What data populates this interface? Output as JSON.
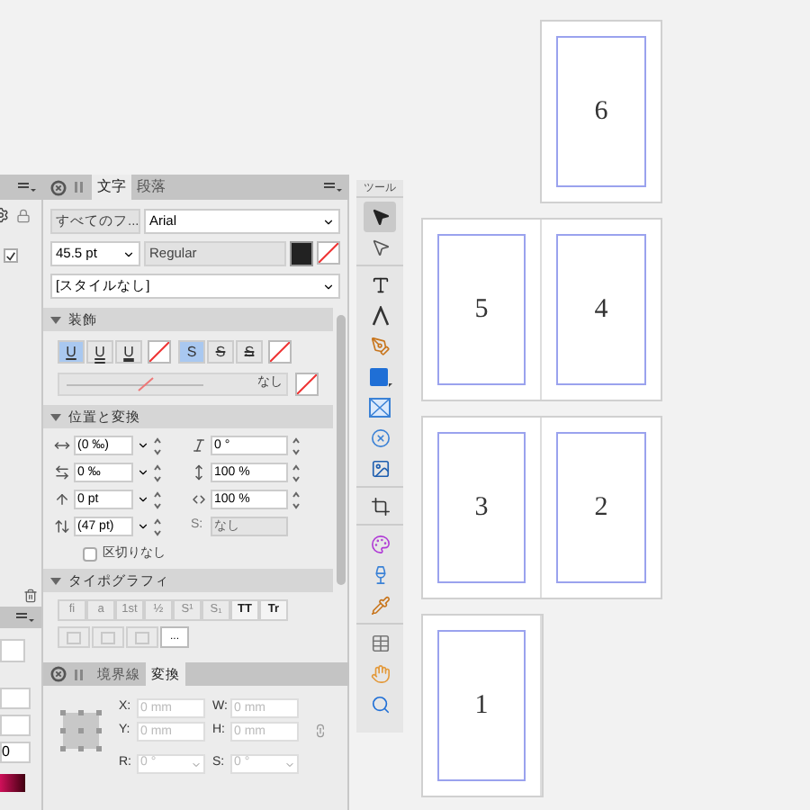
{
  "left_panel": {
    "field_value": "0",
    "checked": true
  },
  "character_panel": {
    "tabs": [
      {
        "label": "文字",
        "selected": true
      },
      {
        "label": "段落",
        "selected": false
      }
    ],
    "font_collection": "すべてのフ...",
    "font": "Arial",
    "size": "45.5 pt",
    "style": "Regular",
    "style_set": "[スタイルなし]",
    "sections": [
      {
        "title": "装飾",
        "expanded": true
      },
      {
        "title": "位置と変換",
        "expanded": true
      },
      {
        "title": "タイポグラフィ",
        "expanded": true
      }
    ],
    "decoration_buttons": [
      {
        "kind": "toggle",
        "label": "U",
        "selected": true
      },
      {
        "kind": "toggle",
        "label": "U",
        "selected": false
      },
      {
        "kind": "toggle",
        "label": "U",
        "selected": false
      },
      {
        "kind": "swatch"
      },
      {
        "kind": "toggle",
        "label": "S",
        "selected": true
      },
      {
        "kind": "toggle",
        "label": "S",
        "selected": false
      },
      {
        "kind": "toggle",
        "label": "S",
        "selected": false
      },
      {
        "kind": "swatch"
      }
    ],
    "line_value": "なし",
    "position_rows": [
      {
        "left_value": "(0 ‰)",
        "right_value": "0 °"
      },
      {
        "left_value": "0 ‰",
        "right_value": "100 %"
      },
      {
        "left_value": "0 pt",
        "right_value": "100 %"
      },
      {
        "left_value": "(47 pt)",
        "right_label": "S:",
        "right_value": "なし"
      }
    ],
    "no_break": {
      "label": "区切りなし",
      "checked": false
    },
    "typography_buttons": [
      {
        "label": "fi",
        "disabled": true
      },
      {
        "label": "a",
        "disabled": true
      },
      {
        "label": "1st",
        "disabled": true
      },
      {
        "label": "½",
        "disabled": true
      },
      {
        "label": "S¹",
        "disabled": true
      },
      {
        "label": "S₁",
        "disabled": true
      },
      {
        "label": "TT",
        "disabled": false
      },
      {
        "label": "Tr",
        "disabled": false
      }
    ],
    "typography_icon_buttons": [
      {
        "disabled": true
      },
      {
        "disabled": true
      },
      {
        "disabled": true
      }
    ],
    "more_button": "..."
  },
  "transform_panel": {
    "tabs": [
      {
        "label": "境界線",
        "selected": false
      },
      {
        "label": "変換",
        "selected": true
      }
    ],
    "fields": [
      {
        "label": "X:",
        "placeholder": "0 mm"
      },
      {
        "label": "W:",
        "placeholder": "0 mm"
      },
      {
        "label": "Y:",
        "placeholder": "0 mm"
      },
      {
        "label": "H:",
        "placeholder": "0 mm"
      }
    ],
    "dropdowns": [
      {
        "label": "R:",
        "placeholder": "0 °"
      },
      {
        "label": "S:",
        "placeholder": "0 °"
      }
    ]
  },
  "tools": {
    "title": "ツール",
    "groups": [
      {
        "tools": [
          {
            "kind": "select",
            "selected": true
          },
          {
            "kind": "node",
            "selected": false
          }
        ]
      },
      {
        "tools": [
          {
            "kind": "text",
            "selected": false
          },
          {
            "kind": "artistic",
            "selected": false
          },
          {
            "kind": "pen",
            "selected": false
          },
          {
            "kind": "rectangle",
            "selected": false
          },
          {
            "kind": "frame",
            "selected": false
          },
          {
            "kind": "ellipse-frame",
            "selected": false
          },
          {
            "kind": "image",
            "selected": false
          }
        ]
      },
      {
        "tools": [
          {
            "kind": "crop",
            "selected": false
          }
        ]
      },
      {
        "tools": [
          {
            "kind": "fill",
            "selected": false
          },
          {
            "kind": "transparency",
            "selected": false
          },
          {
            "kind": "picker",
            "selected": false
          }
        ]
      },
      {
        "tools": [
          {
            "kind": "table",
            "selected": false
          },
          {
            "kind": "hand",
            "selected": false
          },
          {
            "kind": "zoom",
            "selected": false
          }
        ]
      }
    ]
  },
  "spreads": [
    {
      "right": {
        "number": "6"
      }
    },
    {
      "left": {
        "number": "5"
      },
      "right": {
        "number": "4"
      }
    },
    {
      "left": {
        "number": "3"
      },
      "right": {
        "number": "2"
      }
    },
    {
      "left": {
        "number": "1"
      }
    }
  ]
}
